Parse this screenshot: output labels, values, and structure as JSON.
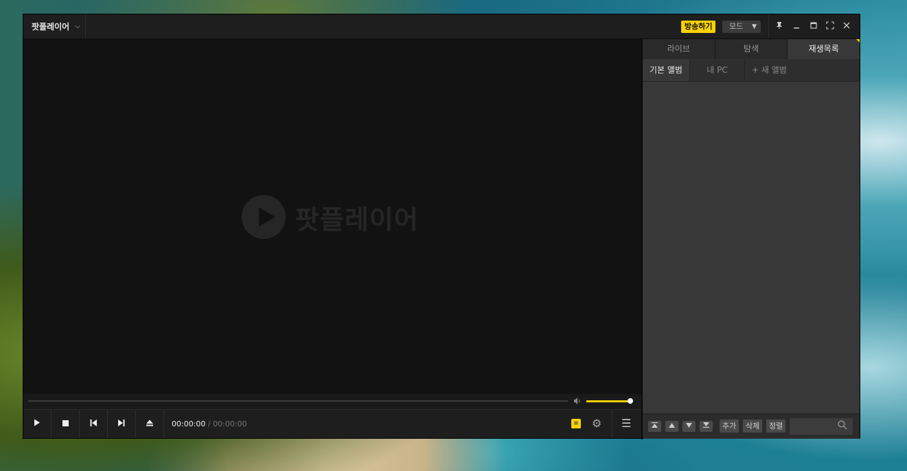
{
  "app": {
    "menu_title": "팟플레이어",
    "menu_chevron": "⌵"
  },
  "titlebar": {
    "broadcast_label": "방송하기",
    "mode_label": "모드",
    "pin_icon": "pin-icon",
    "accent_color": "#f7d200"
  },
  "video": {
    "logo_text": "팟플레이어"
  },
  "playback": {
    "current_time": "00:00:00",
    "separator": "/",
    "total_time": "00:00:00",
    "volume_fraction": 1.0,
    "progress_fraction": 0
  },
  "panel": {
    "tabs": [
      {
        "label": "라이브"
      },
      {
        "label": "탐색"
      },
      {
        "label": "재생목록"
      }
    ],
    "subtabs": [
      {
        "label": "기본 앨범"
      },
      {
        "label": "내 PC"
      },
      {
        "label": "+ 새 앨범"
      }
    ],
    "bottom": {
      "add_label": "추가",
      "delete_label": "삭제",
      "sort_label": "정렬",
      "search_placeholder": ""
    }
  }
}
